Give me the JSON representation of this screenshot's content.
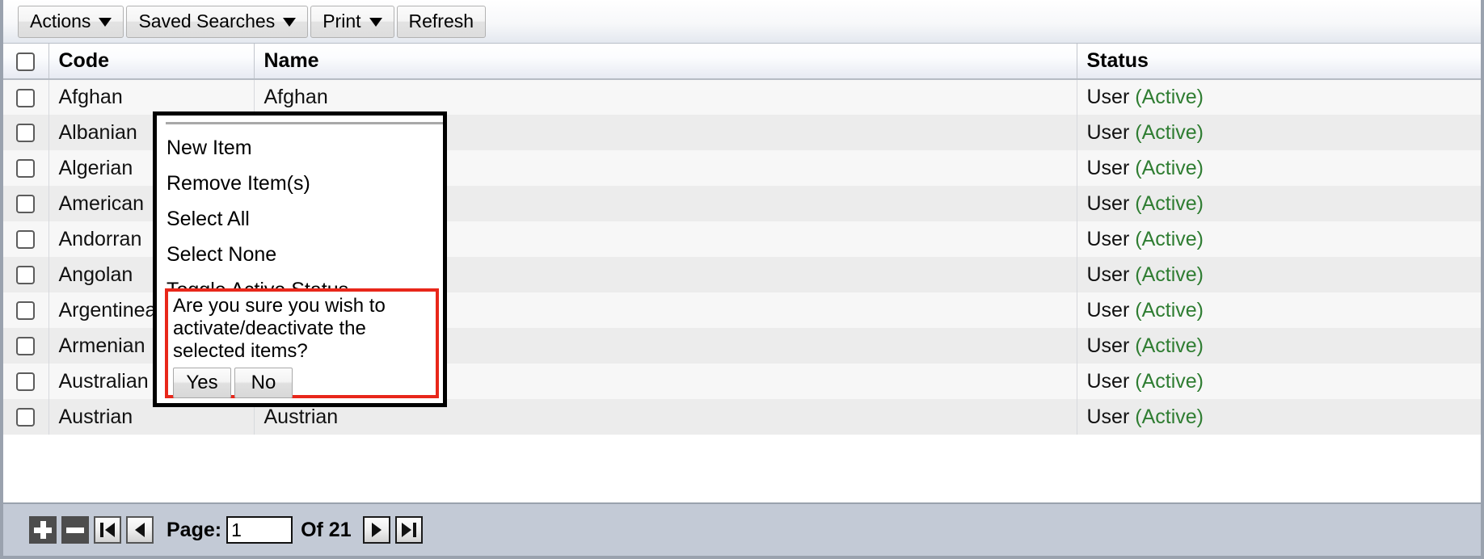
{
  "toolbar": {
    "buttons": [
      {
        "label": "Actions",
        "has_caret": true
      },
      {
        "label": "Saved Searches",
        "has_caret": true
      },
      {
        "label": "Print",
        "has_caret": true
      },
      {
        "label": "Refresh",
        "has_caret": false
      }
    ]
  },
  "grid": {
    "columns": [
      "",
      "Code",
      "Name",
      "Status"
    ],
    "rows": [
      {
        "code": "Afghan",
        "name": "Afghan",
        "status_type": "User",
        "status_state": "(Active)"
      },
      {
        "code": "Albanian",
        "name": "",
        "status_type": "User",
        "status_state": "(Active)"
      },
      {
        "code": "Algerian",
        "name": "",
        "status_type": "User",
        "status_state": "(Active)"
      },
      {
        "code": "American",
        "name": "",
        "status_type": "User",
        "status_state": "(Active)"
      },
      {
        "code": "Andorran",
        "name": "",
        "status_type": "User",
        "status_state": "(Active)"
      },
      {
        "code": "Angolan",
        "name": "",
        "status_type": "User",
        "status_state": "(Active)"
      },
      {
        "code": "Argentinean",
        "name": "",
        "status_type": "User",
        "status_state": "(Active)"
      },
      {
        "code": "Armenian",
        "name": "",
        "status_type": "User",
        "status_state": "(Active)"
      },
      {
        "code": "Australian",
        "name": "",
        "status_type": "User",
        "status_state": "(Active)"
      },
      {
        "code": "Austrian",
        "name": "Austrian",
        "status_type": "User",
        "status_state": "(Active)"
      }
    ]
  },
  "actions_menu": {
    "items": [
      "New Item",
      "Remove Item(s)",
      "Select All",
      "Select None",
      "Toggle Active Status"
    ]
  },
  "confirm": {
    "message": "Are you sure you wish to activate/deactivate the selected items?",
    "yes_label": "Yes",
    "no_label": "No",
    "border_color": "#e8271a"
  },
  "pager": {
    "page_label": "Page:",
    "page_value": "1",
    "of_label": "Of 21",
    "add_icon": "plus-icon",
    "remove_icon": "minus-icon",
    "first_icon": "first-page-icon",
    "prev_icon": "previous-page-icon",
    "next_icon": "next-page-icon",
    "last_icon": "last-page-icon"
  },
  "colors": {
    "active_status": "#2f7d32",
    "pager_background": "#c3cad6",
    "menu_border": "#000000"
  }
}
